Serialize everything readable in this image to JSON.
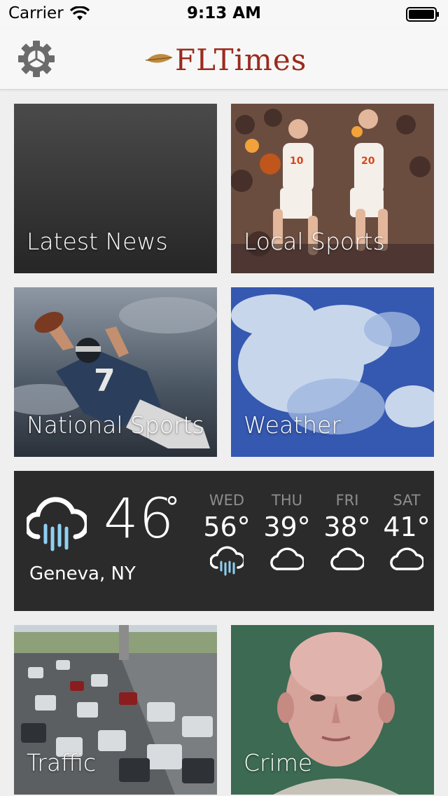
{
  "status_bar": {
    "carrier": "Carrier",
    "time": "9:13 AM"
  },
  "navbar": {
    "logo_text": "FLTimes",
    "settings_icon": "gear-icon"
  },
  "tiles": [
    {
      "label": "Latest News"
    },
    {
      "label": "Local Sports"
    },
    {
      "label": "National Sports"
    },
    {
      "label": "Weather"
    },
    {
      "label": "Traffic"
    },
    {
      "label": "Crime"
    }
  ],
  "weather": {
    "current_temp": "46",
    "degree_symbol": "°",
    "location": "Geneva, NY",
    "current_icon": "rain-cloud-icon",
    "forecast": [
      {
        "day": "WED",
        "temp": "56°",
        "icon": "rain-cloud-icon"
      },
      {
        "day": "THU",
        "temp": "39°",
        "icon": "cloud-icon"
      },
      {
        "day": "FRI",
        "temp": "38°",
        "icon": "cloud-icon"
      },
      {
        "day": "SAT",
        "temp": "41°",
        "icon": "cloud-icon"
      }
    ]
  },
  "colors": {
    "brand": "#9a2b1d",
    "rain_accent": "#8fd0f2",
    "panel": "#2b2b2b"
  }
}
